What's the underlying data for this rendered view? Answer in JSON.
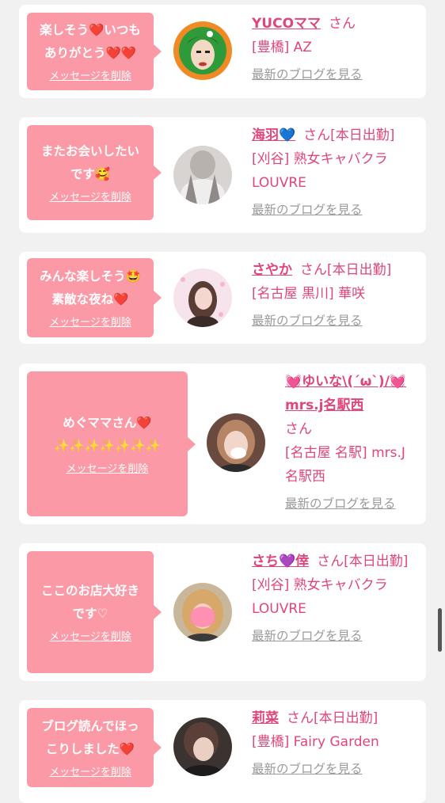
{
  "delete_label": "メッセージを削除",
  "more_label": "最新のブログを見る",
  "san_label": "さん",
  "colors": {
    "bubble": "#fb9aa6",
    "name": "#e0457b",
    "link": "#9a9a9a",
    "page_bg": "#f1f1f1"
  },
  "cards": [
    {
      "message": "楽しそう❤️いつも\nありがとう❤️❤️",
      "name": "YUCOママ",
      "status": "",
      "shop": "[豊橋] AZ",
      "avatar": "green-hair-illustration-avatar"
    },
    {
      "message": "またお会いしたい\nです🥰",
      "name": "海羽💙",
      "status": "[本日出勤]",
      "shop": "[刈谷] 熟女キャバクラ LOUVRE",
      "avatar": "girl-photo-avatar"
    },
    {
      "message": "みんな楽しそう🤩\n素敵な夜ね❤️",
      "name": "さやか",
      "status": "[本日出勤]",
      "shop": "[名古屋 黒川] 華咲",
      "avatar": "girl-photo-avatar"
    },
    {
      "message": "めぐママさん❤️\n✨✨✨✨✨✨✨",
      "name": "💓ゆいな\\(´ω`)/💓mrs.j名駅西",
      "status": "",
      "shop": "[名古屋 名駅] mrs.J 名駅西",
      "avatar": "girl-photo-avatar"
    },
    {
      "message": "ここのお店大好き\nです♡",
      "name": "さち💜倖",
      "status": "[本日出勤]",
      "shop": "[刈谷] 熟女キャバクラ LOUVRE",
      "avatar": "girl-photo-avatar"
    },
    {
      "message": "ブログ読んでほっ\nこりしました❤️",
      "name": "莉菜",
      "status": "[本日出勤]",
      "shop": "[豊橋] Fairy Garden",
      "avatar": "girl-photo-avatar"
    }
  ]
}
